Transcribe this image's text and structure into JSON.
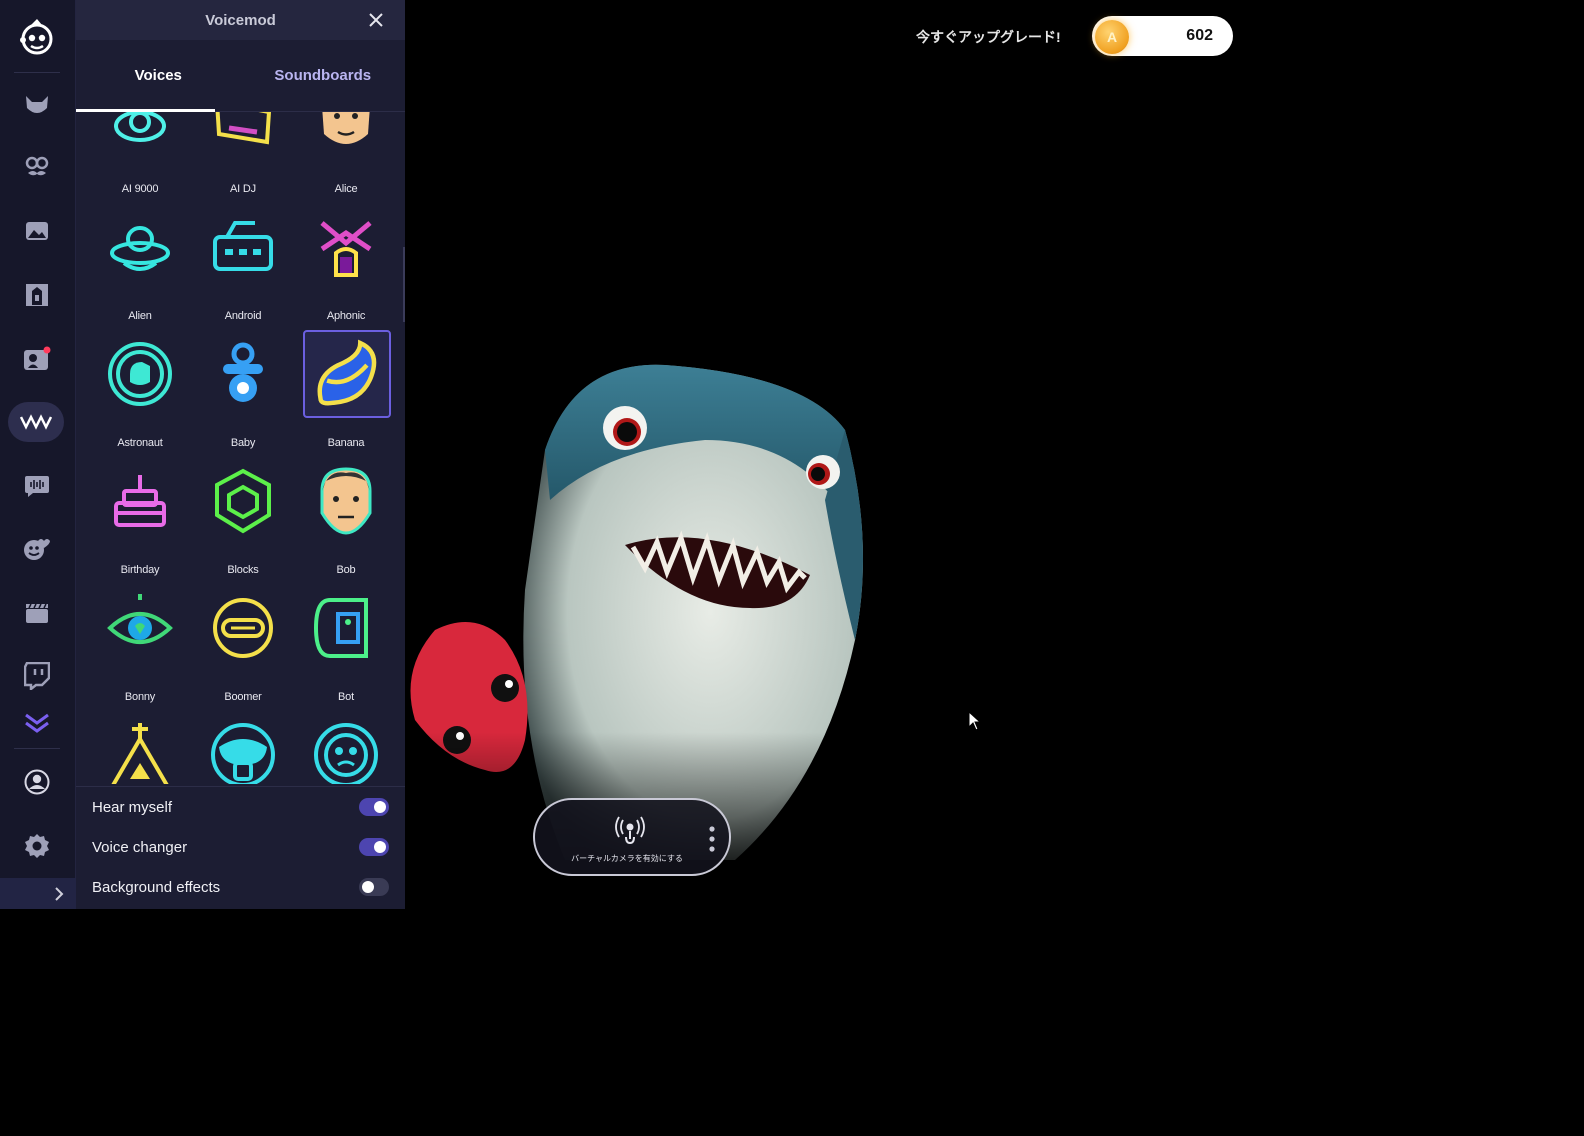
{
  "app": {
    "title": "Voicemod"
  },
  "tabs": [
    {
      "label": "Voices",
      "active": true
    },
    {
      "label": "Soundboards",
      "active": false
    }
  ],
  "rail": {
    "items": [
      "fox-avatar-icon",
      "mustache-mask-icon",
      "image-icon",
      "door-icon",
      "meme-camera-icon",
      "voicelab-icon",
      "voice-lines-icon",
      "heart-smile-icon",
      "clapperboard-icon",
      "twitch-icon",
      "double-chevron-icon",
      "user-account-icon",
      "settings-gear-icon"
    ],
    "active": "voicelab-icon"
  },
  "voices": [
    {
      "label": "AI 9000",
      "color": "#4ff0e8"
    },
    {
      "label": "AI DJ",
      "color": "#f4e04a"
    },
    {
      "label": "Alice",
      "color": "#f3c58f"
    },
    {
      "label": "Alien",
      "color": "#36e6e0"
    },
    {
      "label": "Android",
      "color": "#36dce8"
    },
    {
      "label": "Aphonic",
      "color": "#ffe24a"
    },
    {
      "label": "Astronaut",
      "color": "#3ee8d4"
    },
    {
      "label": "Baby",
      "color": "#2aa8f4"
    },
    {
      "label": "Banana",
      "color": "#f4e04a",
      "selected": true
    },
    {
      "label": "Birthday",
      "color": "#e86be8"
    },
    {
      "label": "Blocks",
      "color": "#5cf04a"
    },
    {
      "label": "Bob",
      "color": "#3ee8c4"
    },
    {
      "label": "Bonny",
      "color": "#40d878"
    },
    {
      "label": "Boomer",
      "color": "#f4e04a"
    },
    {
      "label": "Bot",
      "color": "#4cf08a"
    },
    {
      "label": "",
      "color": "#f4e04a"
    },
    {
      "label": "",
      "color": "#36dce8"
    },
    {
      "label": "",
      "color": "#36dce8"
    }
  ],
  "settings": [
    {
      "label": "Hear myself",
      "on": true
    },
    {
      "label": "Voice changer",
      "on": true
    },
    {
      "label": "Background effects",
      "on": false
    }
  ],
  "header": {
    "upgrade": "今すぐアップグレード!",
    "coins": "602",
    "coin_letter": "A"
  },
  "virtual_camera": {
    "label": "バーチャルカメラを有効にする"
  },
  "colors": {
    "accent": "#4d45b0",
    "panel": "#1c1d33",
    "rail": "#16172a"
  }
}
